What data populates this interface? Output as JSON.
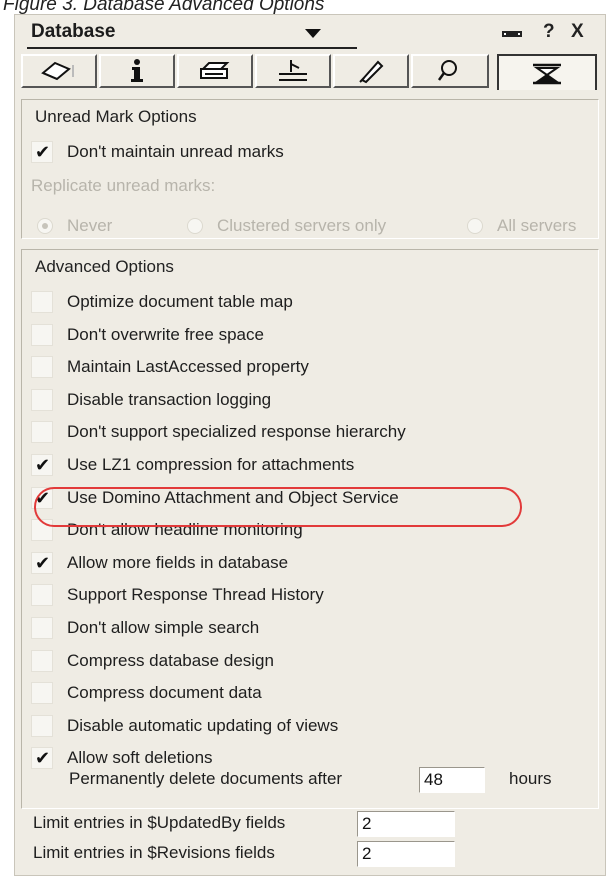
{
  "caption": "Figure 3. Database Advanced Options",
  "panel": {
    "title": "Database",
    "help_label": "?",
    "close_label": "X"
  },
  "tabs": [
    {
      "icon": "eraser-icon"
    },
    {
      "icon": "info-icon"
    },
    {
      "icon": "printer-icon"
    },
    {
      "icon": "ruler-icon"
    },
    {
      "icon": "pen-icon"
    },
    {
      "icon": "search-icon"
    },
    {
      "icon": "hourglass-icon",
      "active": true
    }
  ],
  "unread": {
    "title": "Unread Mark Options",
    "dont_maintain": {
      "label": "Don't maintain unread marks",
      "checked": true
    },
    "replicate_label": "Replicate unread marks:",
    "radios": [
      {
        "label": "Never",
        "selected": true
      },
      {
        "label": "Clustered servers only",
        "selected": false
      },
      {
        "label": "All servers",
        "selected": false
      }
    ]
  },
  "advanced": {
    "title": "Advanced Options",
    "options": [
      {
        "label": "Optimize document table map",
        "checked": false
      },
      {
        "label": "Don't overwrite free space",
        "checked": false
      },
      {
        "label": "Maintain LastAccessed property",
        "checked": false
      },
      {
        "label": "Disable transaction logging",
        "checked": false
      },
      {
        "label": "Don't support specialized response hierarchy",
        "checked": false
      },
      {
        "label": "Use LZ1 compression for attachments",
        "checked": true
      },
      {
        "label": "Use Domino Attachment and Object Service",
        "checked": true
      },
      {
        "label": "Don't allow headline monitoring",
        "checked": false
      },
      {
        "label": "Allow more fields in database",
        "checked": true
      },
      {
        "label": "Support Response Thread History",
        "checked": false
      },
      {
        "label": "Don't allow simple search",
        "checked": false
      },
      {
        "label": "Compress database design",
        "checked": false
      },
      {
        "label": "Compress document data",
        "checked": false
      },
      {
        "label": "Disable automatic updating of views",
        "checked": false
      },
      {
        "label": "Allow soft deletions",
        "checked": true
      }
    ],
    "delete_after": {
      "label": "Permanently delete documents after",
      "value": "48",
      "unit": "hours"
    },
    "updated_by": {
      "label": "Limit entries in $UpdatedBy fields",
      "value": "2"
    },
    "revisions": {
      "label": "Limit entries in $Revisions fields",
      "value": "2"
    }
  },
  "colors": {
    "highlight_ring": "#e23a3a",
    "panel_bg": "#efece4"
  }
}
